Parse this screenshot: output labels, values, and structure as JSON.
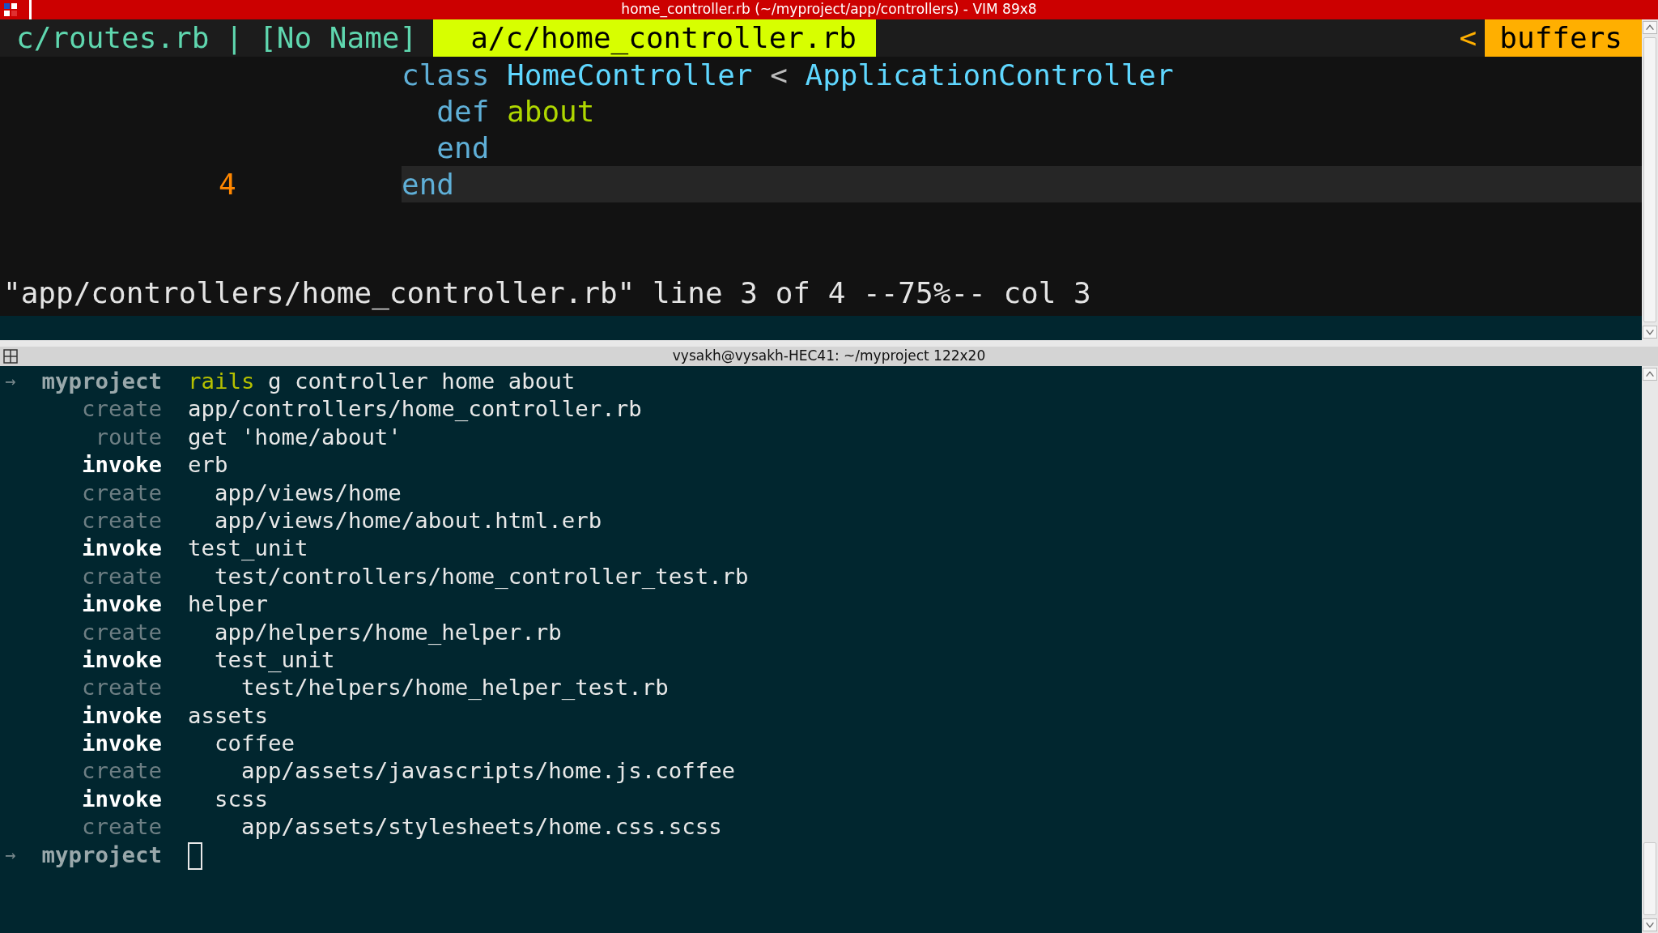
{
  "vim_window": {
    "title": "home_controller.rb (~/myproject/app/controllers) - VIM 89x8",
    "tabs": [
      {
        "label": "c/routes.rb",
        "selected": false,
        "separator": "|"
      },
      {
        "label": "[No Name]",
        "selected": false
      },
      {
        "label": "a/c/home_controller.rb",
        "selected": true
      }
    ],
    "buffers_arrow": "<",
    "buffers_label": "buffers",
    "lines": [
      {
        "current": false,
        "tokens": [
          {
            "kind": "keyword",
            "text": "class "
          },
          {
            "kind": "constant",
            "text": "HomeController"
          },
          {
            "kind": "operator",
            "text": " < "
          },
          {
            "kind": "constant",
            "text": "ApplicationController"
          }
        ]
      },
      {
        "current": false,
        "tokens": [
          {
            "kind": "keyword",
            "text": "  def "
          },
          {
            "kind": "function",
            "text": "about"
          }
        ]
      },
      {
        "current": false,
        "tokens": [
          {
            "kind": "keyword",
            "text": "  end"
          }
        ]
      },
      {
        "number": "4",
        "current": true,
        "tokens": [
          {
            "kind": "keyword",
            "text": "end"
          }
        ]
      }
    ],
    "message": "\"app/controllers/home_controller.rb\" line 3 of 4 --75%-- col 3"
  },
  "terminal_window": {
    "title": "vysakh@vysakh-HEC41: ~/myproject 122x20",
    "lines": [
      {
        "kind": "prompt",
        "arrow": "→",
        "label": "myproject",
        "program": "rails",
        "text": " g controller home about",
        "cursor": false
      },
      {
        "kind": "status",
        "label": "create",
        "emphasis": false,
        "text": "app/controllers/home_controller.rb"
      },
      {
        "kind": "status",
        "label": "route",
        "emphasis": false,
        "text": "get 'home/about'"
      },
      {
        "kind": "status",
        "label": "invoke",
        "emphasis": true,
        "text": "erb"
      },
      {
        "kind": "status",
        "label": "create",
        "emphasis": false,
        "text": "  app/views/home"
      },
      {
        "kind": "status",
        "label": "create",
        "emphasis": false,
        "text": "  app/views/home/about.html.erb"
      },
      {
        "kind": "status",
        "label": "invoke",
        "emphasis": true,
        "text": "test_unit"
      },
      {
        "kind": "status",
        "label": "create",
        "emphasis": false,
        "text": "  test/controllers/home_controller_test.rb"
      },
      {
        "kind": "status",
        "label": "invoke",
        "emphasis": true,
        "text": "helper"
      },
      {
        "kind": "status",
        "label": "create",
        "emphasis": false,
        "text": "  app/helpers/home_helper.rb"
      },
      {
        "kind": "status",
        "label": "invoke",
        "emphasis": true,
        "text": "  test_unit"
      },
      {
        "kind": "status",
        "label": "create",
        "emphasis": false,
        "text": "    test/helpers/home_helper_test.rb"
      },
      {
        "kind": "status",
        "label": "invoke",
        "emphasis": true,
        "text": "assets"
      },
      {
        "kind": "status",
        "label": "invoke",
        "emphasis": true,
        "text": "  coffee"
      },
      {
        "kind": "status",
        "label": "create",
        "emphasis": false,
        "text": "    app/assets/javascripts/home.js.coffee"
      },
      {
        "kind": "status",
        "label": "invoke",
        "emphasis": true,
        "text": "  scss"
      },
      {
        "kind": "status",
        "label": "create",
        "emphasis": false,
        "text": "    app/assets/stylesheets/home.css.scss"
      },
      {
        "kind": "prompt",
        "arrow": "→",
        "label": "myproject",
        "cursor": true
      }
    ]
  }
}
